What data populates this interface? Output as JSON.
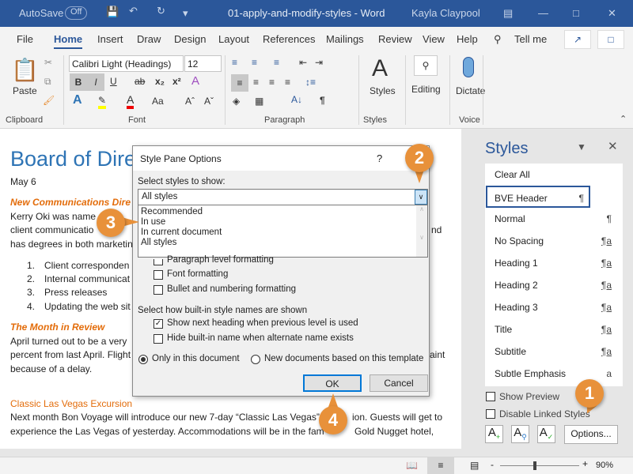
{
  "titlebar": {
    "autosave": "AutoSave",
    "autosave_state": "Off",
    "title": "01-apply-and-modify-styles - Word",
    "user": "Kayla Claypool"
  },
  "tabs": [
    "File",
    "Home",
    "Insert",
    "Draw",
    "Design",
    "Layout",
    "References",
    "Mailings",
    "Review",
    "View",
    "Help",
    "Tell me"
  ],
  "ribbon": {
    "paste": "Paste",
    "font_name": "Calibri Light (Headings)",
    "font_size": "12",
    "styles": "Styles",
    "editing": "Editing",
    "dictate": "Dictate",
    "groups": [
      "Clipboard",
      "Font",
      "Paragraph",
      "Styles",
      "Voice"
    ]
  },
  "document": {
    "title": "Board of Dire",
    "date": "May 6",
    "h1": "New Communications Dire",
    "p1": [
      "Kerry Oki was name",
      "client communicatio",
      "has degrees in both marketin"
    ],
    "p1_right": [
      "",
      "nd",
      ""
    ],
    "list": [
      "Client corresponden",
      "Internal communicat",
      "Press releases",
      "Updating the web sit"
    ],
    "h2": "The Month in Review",
    "p2": [
      "April turned out to be a very",
      "percent from last April. Flight",
      "because of a delay."
    ],
    "p2_right": "aint",
    "h3": "Classic Las Vegas Excursion",
    "p3": [
      "Next month Bon Voyage will introduce our new 7-day “Classic Las Vegas”",
      "experience the Las Vegas of yesterday. Accommodations will be in the fam"
    ],
    "p3_right": [
      "ion. Guests will get to",
      "Gold Nugget hotel,"
    ]
  },
  "styles_pane": {
    "title": "Styles",
    "items": [
      {
        "name": "Clear All",
        "glyph": ""
      },
      {
        "name": "BVE Header",
        "glyph": "¶"
      },
      {
        "name": "Normal",
        "glyph": "¶"
      },
      {
        "name": "No Spacing",
        "glyph": "¶a"
      },
      {
        "name": "Heading 1",
        "glyph": "¶a"
      },
      {
        "name": "Heading 2",
        "glyph": "¶a"
      },
      {
        "name": "Heading 3",
        "glyph": "¶a"
      },
      {
        "name": "Title",
        "glyph": "¶a"
      },
      {
        "name": "Subtitle",
        "glyph": "¶a"
      },
      {
        "name": "Subtle Emphasis",
        "glyph": "a"
      }
    ],
    "show_preview": "Show Preview",
    "disable_linked": "Disable Linked Styles",
    "options": "Options..."
  },
  "dialog": {
    "title": "Style Pane Options",
    "help": "?",
    "select_label": "Select styles to show:",
    "selected": "All styles",
    "options": [
      "Recommended",
      "In use",
      "In current document",
      "All styles"
    ],
    "checks": [
      {
        "label": "Paragraph level formatting",
        "checked": false
      },
      {
        "label": "Font formatting",
        "checked": false
      },
      {
        "label": "Bullet and numbering formatting",
        "checked": false
      }
    ],
    "names_label": "Select how built-in style names are shown",
    "name_checks": [
      {
        "label": "Show next heading when previous level is used",
        "checked": true
      },
      {
        "label": "Hide built-in name when alternate name exists",
        "checked": false
      }
    ],
    "radio1": "Only in this document",
    "radio2": "New documents based on this template",
    "ok": "OK",
    "cancel": "Cancel"
  },
  "status": {
    "zoom": "90%"
  },
  "callouts": [
    "1",
    "2",
    "3",
    "4"
  ],
  "colors": {
    "brand": "#2b579a",
    "callout": "#e8913a",
    "heading": "#2e74b5",
    "accent_heading": "#e36c0a"
  }
}
